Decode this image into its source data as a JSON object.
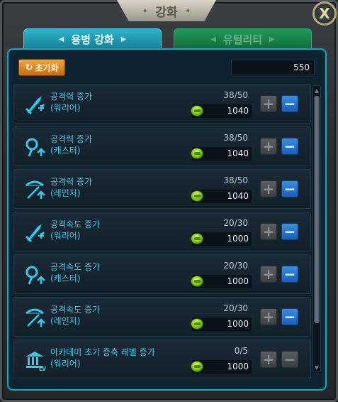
{
  "window": {
    "title": "강화",
    "title_deco_left": "✦",
    "title_deco_right": "✦",
    "close_label": "X"
  },
  "tabs": [
    {
      "label": "용병 강화",
      "active": true
    },
    {
      "label": "유틸리티",
      "active": false
    }
  ],
  "toolbar": {
    "reset_label": "초기화",
    "reset_icon": "↻",
    "currency_amount": "550"
  },
  "upgrades": [
    {
      "name": "공격력 증가",
      "class": "(워리어)",
      "level": "38/50",
      "cost": "1040",
      "icon": "sword-icon",
      "minus_enabled": true
    },
    {
      "name": "공격력 증가",
      "class": "(캐스터)",
      "level": "38/50",
      "cost": "1040",
      "icon": "caster-icon",
      "minus_enabled": true
    },
    {
      "name": "공격력 증가",
      "class": "(레인저)",
      "level": "38/50",
      "cost": "1040",
      "icon": "bow-icon",
      "minus_enabled": true
    },
    {
      "name": "공격속도 증가",
      "class": "(워리어)",
      "level": "20/30",
      "cost": "1000",
      "icon": "sword-icon",
      "minus_enabled": true
    },
    {
      "name": "공격속도 증가",
      "class": "(캐스터)",
      "level": "20/30",
      "cost": "1000",
      "icon": "caster-icon",
      "minus_enabled": true
    },
    {
      "name": "공격속도 증가",
      "class": "(레인저)",
      "level": "20/30",
      "cost": "1000",
      "icon": "bow-icon",
      "minus_enabled": true
    },
    {
      "name": "아카데미 초기 증축 레벨 증가",
      "class": "(워리어)",
      "level": "0/5",
      "cost": "1000",
      "icon": "academy-icon",
      "minus_enabled": false
    }
  ],
  "buttons": {
    "plus": "+",
    "minus": "−"
  },
  "scroll": {
    "up": "▲",
    "down": "▼"
  },
  "colors": {
    "accent": "#1fa3bb",
    "active_tab": "#2fb3c9",
    "inactive_tab": "#229a58",
    "reset": "#e8902a",
    "minus": "#2b7bd1"
  }
}
